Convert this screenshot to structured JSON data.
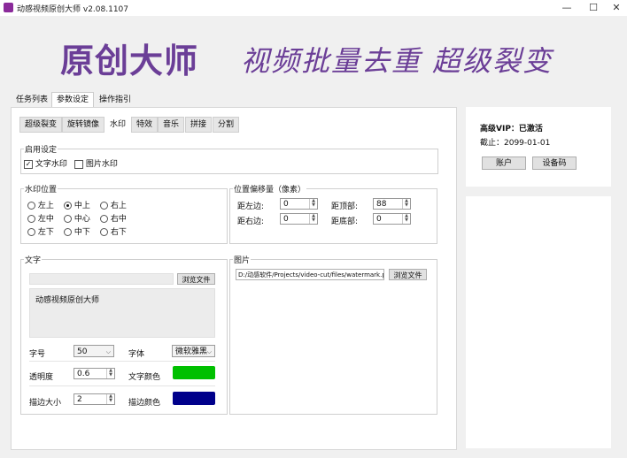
{
  "window": {
    "title": "动感视频原创大师 v2.08.1107",
    "minimize": "—",
    "maximize": "☐",
    "close": "✕"
  },
  "banner": {
    "main": "原创大师",
    "sub": "视频批量去重  超级裂变"
  },
  "main_tabs": [
    "任务列表",
    "参数设定",
    "操作指引"
  ],
  "sub_tabs": [
    "超级裂变",
    "旋转镜像",
    "水印",
    "特效",
    "音乐",
    "拼接",
    "分割"
  ],
  "enable": {
    "title": "启用设定",
    "text_wm": "文字水印",
    "image_wm": "图片水印",
    "text_checked": true,
    "image_checked": false
  },
  "position": {
    "title": "水印位置",
    "options": [
      "左上",
      "中上",
      "右上",
      "左中",
      "中心",
      "右中",
      "左下",
      "中下",
      "右下"
    ],
    "selected": "中上"
  },
  "offset": {
    "title": "位置偏移量（像素）",
    "left_label": "距左边:",
    "left_value": "0",
    "top_label": "距顶部:",
    "top_value": "88",
    "right_label": "距右边:",
    "right_value": "0",
    "bottom_label": "距底部:",
    "bottom_value": "0"
  },
  "text_group": {
    "title": "文字",
    "browse": "浏览文件",
    "content": "动感视频原创大师",
    "size_label": "字号",
    "size_value": "50",
    "font_label": "字体",
    "font_value": "微软雅黑",
    "opacity_label": "透明度",
    "opacity_value": "0.6",
    "color_label": "文字颜色",
    "text_color": "#00c000",
    "stroke_label": "描边大小",
    "stroke_value": "2",
    "stroke_color_label": "描边颜色",
    "stroke_color": "#00008b"
  },
  "image_group": {
    "title": "图片",
    "path": "D:/动感软件/Projects/video-cut/files/watermark.png",
    "browse": "浏览文件"
  },
  "vip": {
    "status": "高级VIP：已激活",
    "expiry": "截止：2099-01-01",
    "account": "账户",
    "device_code": "设备码"
  },
  "accent_color": "#6b3e97"
}
